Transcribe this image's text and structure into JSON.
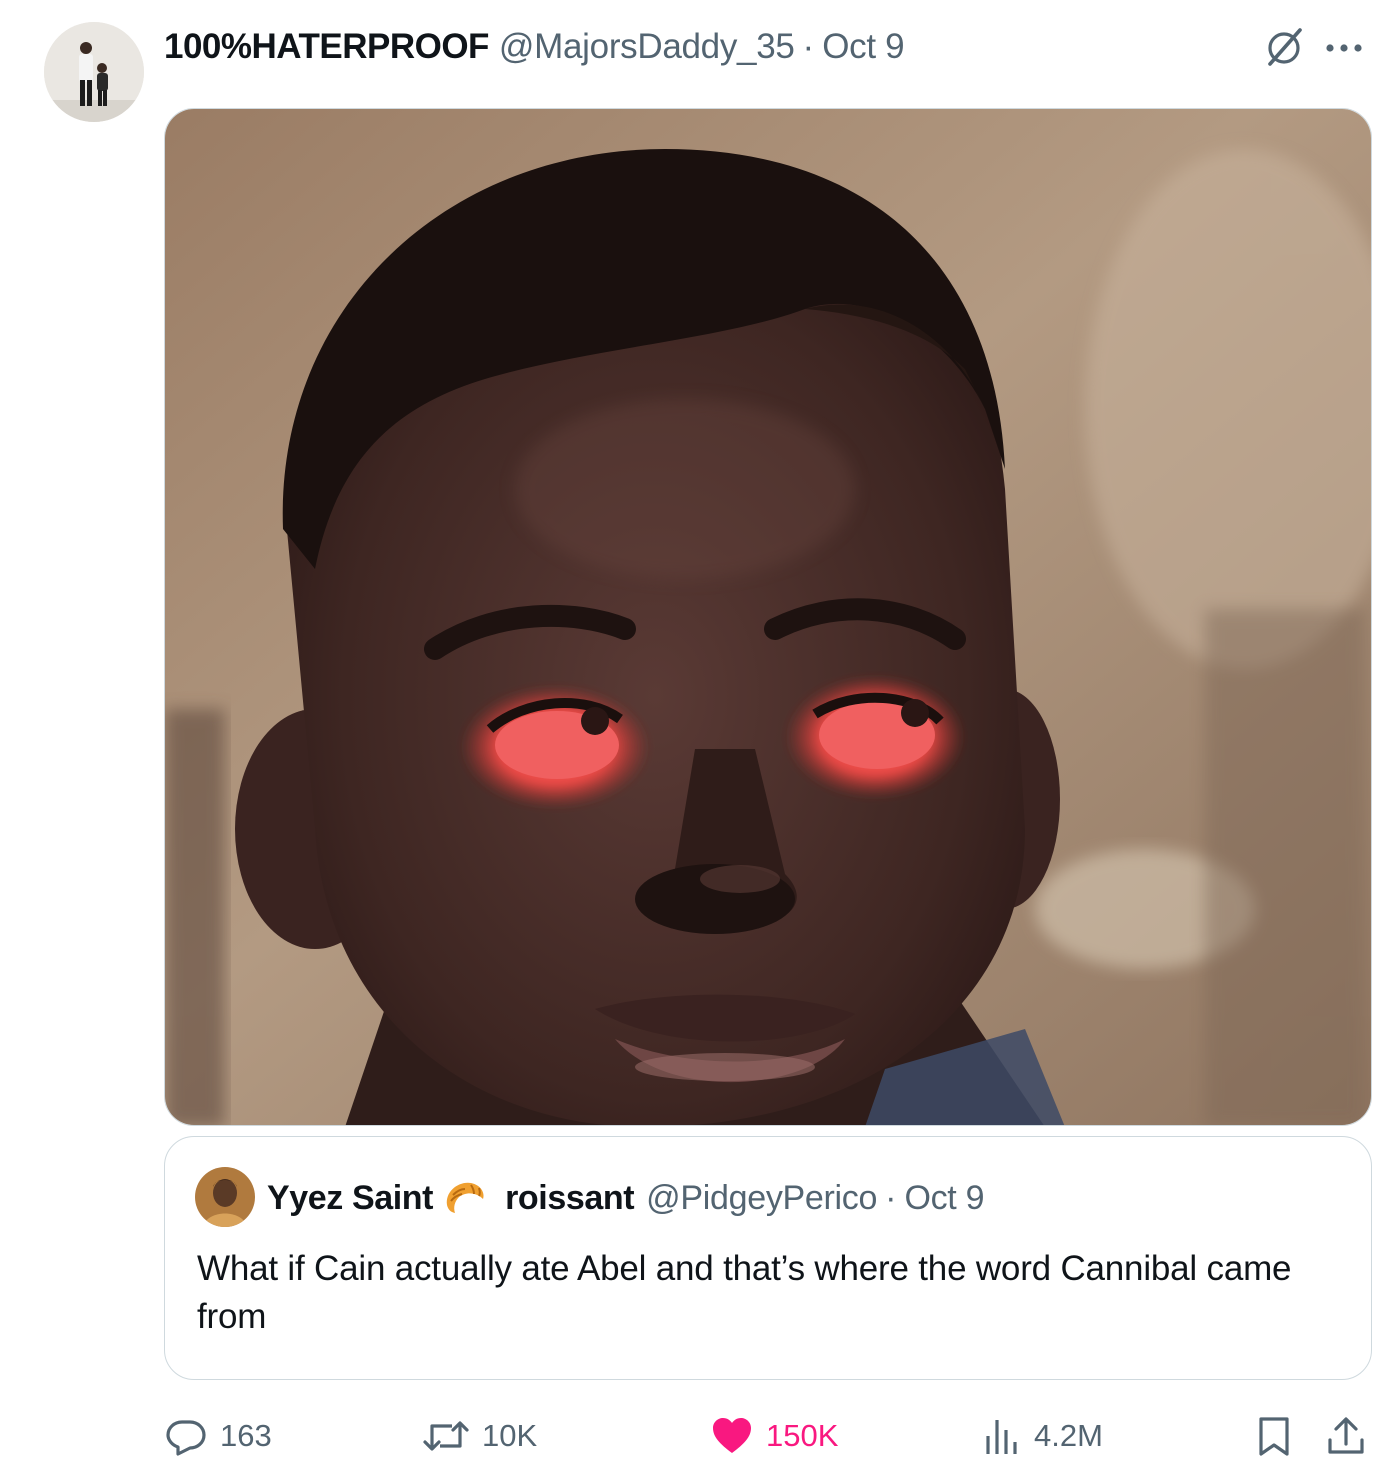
{
  "tweet": {
    "author_name": "100%HATERPROOF",
    "author_handle": "@MajorsDaddy_35",
    "separator": "·",
    "date": "Oct 9",
    "icons": {
      "avatar": "profile-photo",
      "grok": "grok-icon",
      "more": "more-options-icon"
    }
  },
  "quote": {
    "name_part1": "Yyez Saint",
    "name_emoji": "croissant-emoji",
    "name_part2": "roissant",
    "handle": "@PidgeyPerico",
    "separator": "·",
    "date": "Oct 9",
    "text": "What if Cain actually ate Abel and that’s where the word Cannibal came from"
  },
  "actions": {
    "replies": "163",
    "reposts": "10K",
    "likes": "150K",
    "views": "4.2M",
    "liked": true,
    "colors": {
      "muted": "#536471",
      "like": "#f91880",
      "text": "#0f1419",
      "border": "#cfd9de"
    }
  }
}
